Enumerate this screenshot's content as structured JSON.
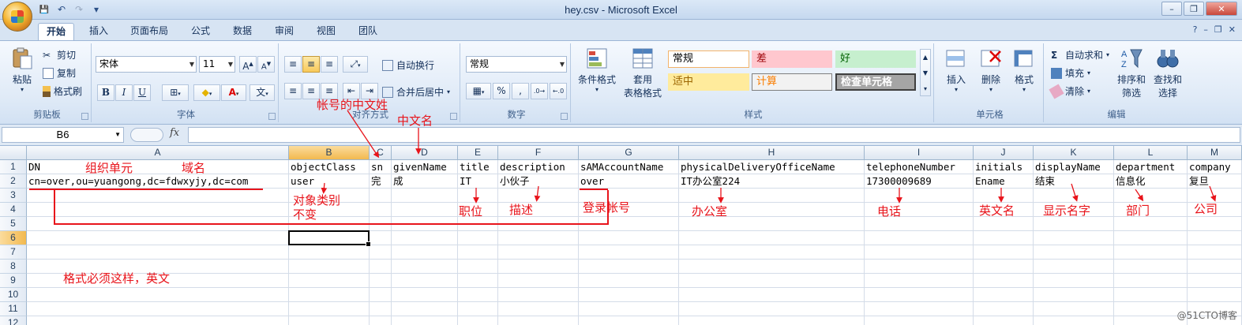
{
  "window": {
    "title": "hey.csv - Microsoft Excel"
  },
  "qat": {
    "save": "💾",
    "undo": "↶",
    "redo": "↷",
    "customize": "▾"
  },
  "tabs": [
    "开始",
    "插入",
    "页面布局",
    "公式",
    "数据",
    "审阅",
    "视图",
    "团队"
  ],
  "clipboard": {
    "paste": "粘贴",
    "cut": "剪切",
    "copy": "复制",
    "format_painter": "格式刷",
    "label": "剪贴板"
  },
  "font": {
    "name": "宋体",
    "size": "11",
    "grow": "A",
    "shrink": "A",
    "bold": "B",
    "italic": "I",
    "underline": "U",
    "phonetic": "文",
    "label": "字体"
  },
  "alignment": {
    "wrap": "自动换行",
    "merge": "合并后居中",
    "label": "对齐方式"
  },
  "number": {
    "format": "常规",
    "percent": "%",
    "comma": ",",
    "label": "数字"
  },
  "styles": {
    "conditional": "条件格式",
    "table_format_1": "套用",
    "table_format_2": "表格格式",
    "cells": [
      {
        "text": "常规",
        "bg": "#ffffff",
        "fg": "#000000",
        "border": "#f2b36b"
      },
      {
        "text": "差",
        "bg": "#ffc7ce",
        "fg": "#9c0006",
        "border": "#ffc7ce"
      },
      {
        "text": "好",
        "bg": "#c6efce",
        "fg": "#006100",
        "border": "#c6efce"
      },
      {
        "text": "适中",
        "bg": "#ffeb9c",
        "fg": "#9c6500",
        "border": "#ffeb9c"
      },
      {
        "text": "计算",
        "bg": "#f2f2f2",
        "fg": "#fa7d00",
        "border": "#7f7f7f"
      },
      {
        "text": "检查单元格",
        "bg": "#a5a5a5",
        "fg": "#ffffff",
        "border": "#3f3f3f"
      }
    ],
    "label": "样式"
  },
  "cells_group": {
    "insert": "插入",
    "delete": "删除",
    "format": "格式",
    "label": "单元格"
  },
  "editing": {
    "autosum": "自动求和",
    "fill": "填充",
    "clear": "清除",
    "sort_1": "排序和",
    "sort_2": "筛选",
    "find_1": "查找和",
    "find_2": "选择",
    "label": "编辑"
  },
  "formula_bar": {
    "name_box": "B6",
    "fx": "fx",
    "value": ""
  },
  "columns": [
    "A",
    "B",
    "C",
    "D",
    "E",
    "F",
    "G",
    "H",
    "I",
    "J",
    "K",
    "L",
    "M"
  ],
  "rows": [
    "1",
    "2",
    "3",
    "4",
    "5",
    "6",
    "7",
    "8",
    "9",
    "10",
    "11",
    "12"
  ],
  "sheet": {
    "row1": [
      "DN",
      "objectClass",
      "sn",
      "givenName",
      "title",
      "description",
      "sAMAccountName",
      "physicalDeliveryOfficeName",
      "telephoneNumber",
      "initials",
      "displayName",
      "department",
      "company"
    ],
    "row2": [
      "cn=over,ou=yuangong,dc=fdwxyjy,dc=com",
      "user",
      "完",
      "成",
      "IT",
      "小伙子",
      "over",
      "IT办公室224",
      "17300009689",
      "Ename",
      "结束",
      "信息化",
      "复旦"
    ]
  },
  "annotations": {
    "org_unit": "组织单元",
    "domain": "域名",
    "sn_cn": "帐号的中文姓",
    "given_cn": "中文名",
    "object_class_1": "对象类别",
    "object_class_2": "不变",
    "title_cn": "职位",
    "desc_cn": "描述",
    "login_cn": "登录帐号",
    "office_cn": "办公室",
    "phone_cn": "电话",
    "initials_cn": "英文名",
    "display_cn": "显示名字",
    "dept_cn": "部门",
    "company_cn": "公司",
    "format_note": "格式必须这样，英文"
  },
  "watermark": "@51CTO博客"
}
